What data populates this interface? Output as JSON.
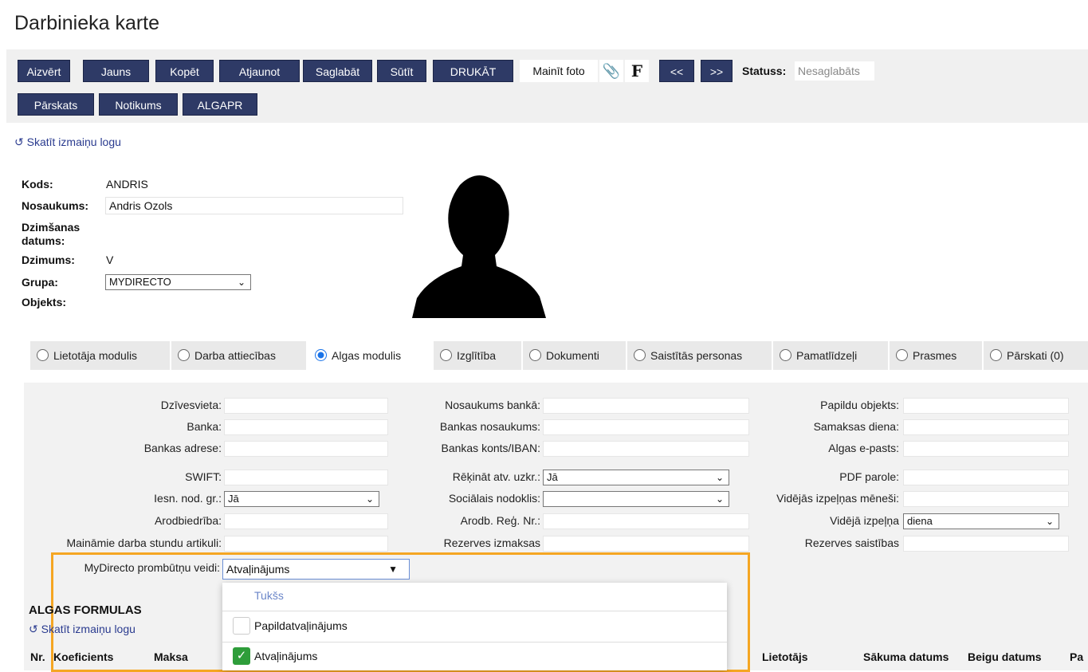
{
  "title": "Darbinieka karte",
  "toolbar": {
    "row1": [
      "Aizvērt",
      "Jauns",
      "Kopēt",
      "Atjaunot",
      "Saglabāt",
      "Sūtīt",
      "DRUKĀT"
    ],
    "change_photo": "Mainīt foto",
    "f_label": "F",
    "prev": "<<",
    "next": ">>",
    "status_label": "Statuss:",
    "status_value": "Nesaglabāts",
    "row2": [
      "Pārskats",
      "Notikums",
      "ALGAPR"
    ]
  },
  "history_link": "Skatīt izmaiņu logu",
  "history_icon": "history-icon",
  "info": {
    "code_label": "Kods:",
    "code_value": "ANDRIS",
    "name_label": "Nosaukums:",
    "name_value": "Andris Ozols",
    "birth_label": "Dzimšanas datums:",
    "gender_label": "Dzimums:",
    "gender_value": "V",
    "group_label": "Grupa:",
    "group_value": "MYDIRECTO",
    "object_label": "Objekts:"
  },
  "tabs": [
    {
      "label": "Lietotāja modulis",
      "active": false
    },
    {
      "label": "Darba attiecības",
      "active": false
    },
    {
      "label": "Algas modulis",
      "active": true
    },
    {
      "label": "Izglītība",
      "active": false
    },
    {
      "label": "Dokumenti",
      "active": false
    },
    {
      "label": "Saistītās personas",
      "active": false
    },
    {
      "label": "Pamatlīdzeļi",
      "active": false
    },
    {
      "label": "Prasmes",
      "active": false
    },
    {
      "label": "Pārskati (0)",
      "active": false
    }
  ],
  "form": {
    "col1": [
      "Dzīvesvieta:",
      "Banka:",
      "Bankas adrese:",
      "SWIFT:",
      "Iesn. nod. gr.:",
      "Arodbiedrība:",
      "Maināmie darba stundu artikuli:"
    ],
    "col1_select_value": "Jā",
    "col2": [
      "Nosaukums bankā:",
      "Bankas nosaukums:",
      "Bankas konts/IBAN:",
      "Rēķināt atv. uzkr.:",
      "Sociālais nodoklis:",
      "Arodb. Reģ. Nr.:",
      "Rezerves izmaksas"
    ],
    "col2_select_value": "Jā",
    "col3": [
      "Papildu objekts:",
      "Samaksas diena:",
      "Algas e-pasts:",
      "PDF parole:",
      "Vidējās izpeļņas mēneši:",
      "Vidējā izpeļņa",
      "Rezerves saistības"
    ],
    "col3_select_value": "diena",
    "absence_label": "MyDirecto prombūtņu veidi:",
    "absence_value": "Atvaļinājums"
  },
  "dropdown": {
    "empty": "Tukšs",
    "options": [
      {
        "label": "Papildatvaļinājums",
        "checked": false
      },
      {
        "label": "Atvaļinājums",
        "checked": true
      }
    ]
  },
  "formulas": {
    "heading": "ALGAS FORMULAS",
    "link": "Skatīt izmaiņu logu",
    "headers_left": [
      "Nr.",
      "Koeficients",
      "Maksa"
    ],
    "headers_right": [
      "Lietotājs",
      "Sākuma datums",
      "Beigu datums",
      "Pa"
    ]
  },
  "colors": {
    "button": "#2e3a66",
    "highlight": "#f5a623",
    "check": "#2e9d3a"
  }
}
